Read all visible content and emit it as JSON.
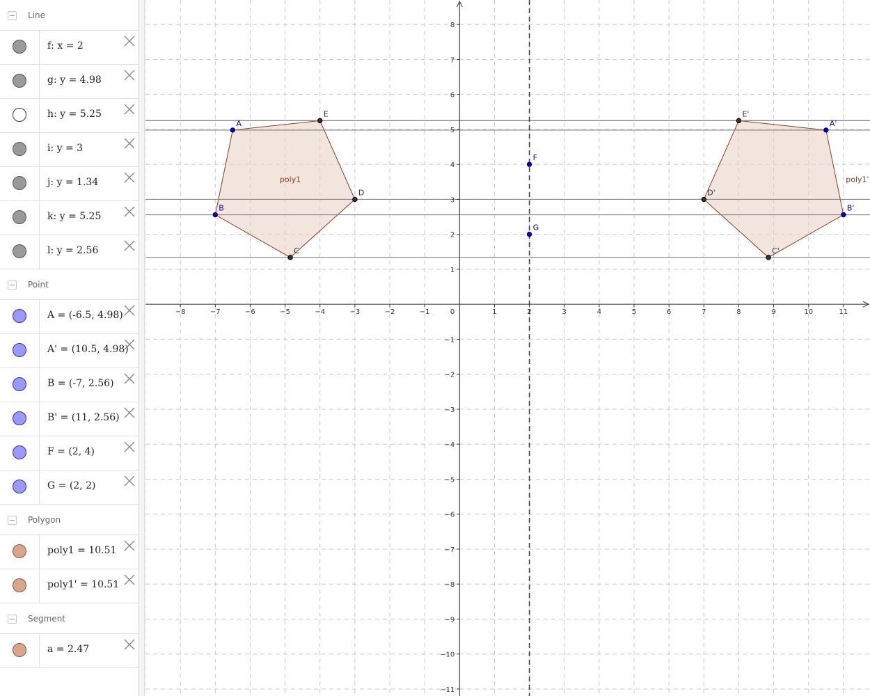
{
  "algebra": {
    "categories": [
      {
        "name": "Line",
        "items": [
          {
            "text": "f: x = 2",
            "marble": "gray"
          },
          {
            "text": "g: y = 4.98",
            "marble": "gray"
          },
          {
            "text": "h: y = 5.25",
            "marble": "white"
          },
          {
            "text": "i: y = 3",
            "marble": "gray"
          },
          {
            "text": "j: y = 1.34",
            "marble": "gray"
          },
          {
            "text": "k: y = 5.25",
            "marble": "gray"
          },
          {
            "text": "l: y = 2.56",
            "marble": "gray"
          }
        ]
      },
      {
        "name": "Point",
        "items": [
          {
            "text": "A = (-6.5, 4.98)",
            "marble": "blue"
          },
          {
            "text": "A' = (10.5, 4.98)",
            "marble": "blue"
          },
          {
            "text": "B = (-7, 2.56)",
            "marble": "blue"
          },
          {
            "text": "B' = (11, 2.56)",
            "marble": "blue"
          },
          {
            "text": "F = (2, 4)",
            "marble": "blue"
          },
          {
            "text": "G = (2, 2)",
            "marble": "blue"
          }
        ]
      },
      {
        "name": "Polygon",
        "items": [
          {
            "text": "poly1 = 10.51",
            "marble": "tan"
          },
          {
            "text": "poly1' = 10.51",
            "marble": "tan"
          }
        ]
      },
      {
        "name": "Segment",
        "items": [
          {
            "text": "a = 2.47",
            "marble": "tan"
          }
        ]
      }
    ]
  },
  "graph": {
    "x_range": [
      -9,
      11.76
    ],
    "y_range": [
      -11.2,
      8.7
    ],
    "x_ticks": [
      -8,
      -7,
      -6,
      -5,
      -4,
      -3,
      -2,
      -1,
      1,
      2,
      3,
      4,
      5,
      6,
      7,
      8,
      9,
      10,
      11
    ],
    "y_ticks": [
      -11,
      -10,
      -9,
      -8,
      -7,
      -6,
      -5,
      -4,
      -3,
      -2,
      -1,
      1,
      2,
      3,
      4,
      5,
      6,
      7,
      8
    ],
    "origin_label": "0",
    "horizontal_lines": [
      4.98,
      5.25,
      3,
      1.34,
      5.25,
      2.56
    ],
    "vertical_line_x": 2,
    "polygons": [
      {
        "label": "poly1",
        "label_at": [
          -4.85,
          3.5
        ],
        "vertices": [
          [
            -6.5,
            4.98
          ],
          [
            -4,
            5.25
          ],
          [
            -3,
            3
          ],
          [
            -4.85,
            1.34
          ],
          [
            -7,
            2.56
          ]
        ]
      },
      {
        "label": "poly1'",
        "label_at": [
          11.4,
          3.5
        ],
        "vertices": [
          [
            10.5,
            4.98
          ],
          [
            8,
            5.25
          ],
          [
            7,
            3
          ],
          [
            8.85,
            1.34
          ],
          [
            11,
            2.56
          ]
        ]
      }
    ],
    "points": [
      {
        "label": "A",
        "x": -6.5,
        "y": 4.98,
        "color": "#0000cc"
      },
      {
        "label": "E",
        "x": -4,
        "y": 5.25,
        "color": "#333333"
      },
      {
        "label": "D",
        "x": -3,
        "y": 3,
        "color": "#333333"
      },
      {
        "label": "C",
        "x": -4.85,
        "y": 1.34,
        "color": "#333333"
      },
      {
        "label": "B",
        "x": -7,
        "y": 2.56,
        "color": "#0000cc"
      },
      {
        "label": "A'",
        "x": 10.5,
        "y": 4.98,
        "color": "#0000cc"
      },
      {
        "label": "E'",
        "x": 8,
        "y": 5.25,
        "color": "#333333"
      },
      {
        "label": "D'",
        "x": 7,
        "y": 3,
        "color": "#333333"
      },
      {
        "label": "C'",
        "x": 8.85,
        "y": 1.34,
        "color": "#333333"
      },
      {
        "label": "B'",
        "x": 11,
        "y": 2.56,
        "color": "#0000cc"
      },
      {
        "label": "F",
        "x": 2,
        "y": 4,
        "color": "#0000cc"
      },
      {
        "label": "G",
        "x": 2,
        "y": 2,
        "color": "#0000cc"
      }
    ],
    "colors": {
      "polygon_fill": "#e8cfc2",
      "polygon_edge": "#8b3a1a",
      "poly_label": "#8b3a1a",
      "line": "#888888"
    }
  }
}
